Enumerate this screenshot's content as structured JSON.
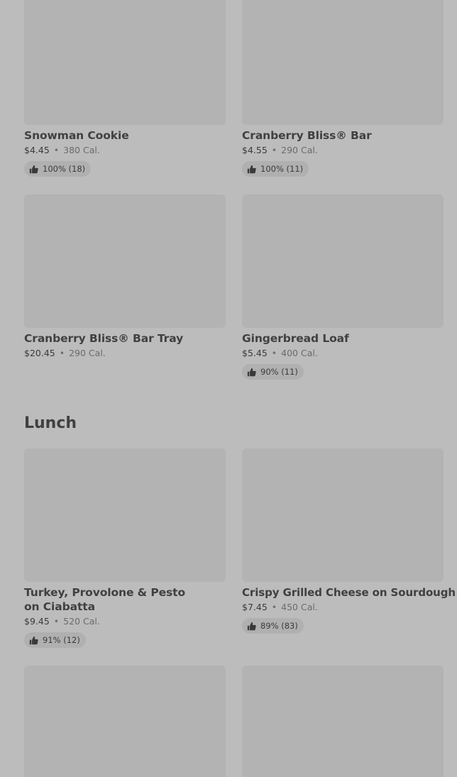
{
  "bakery": {
    "items": [
      {
        "name": "Snowman Cookie",
        "price": "$4.45",
        "sep": "•",
        "calories": "380 Cal.",
        "rating": "100% (18)"
      },
      {
        "name": "Cranberry Bliss® Bar",
        "price": "$4.55",
        "sep": "•",
        "calories": "290 Cal.",
        "rating": "100% (11)"
      },
      {
        "name": "Cranberry Bliss® Bar Tray",
        "price": "$20.45",
        "sep": "•",
        "calories": "290 Cal."
      },
      {
        "name": "Gingerbread Loaf",
        "price": "$5.45",
        "sep": "•",
        "calories": "400 Cal.",
        "rating": "90% (11)"
      }
    ]
  },
  "lunch": {
    "title": "Lunch",
    "items": [
      {
        "name": "Turkey, Provolone & Pesto on Ciabatta",
        "price": "$9.45",
        "sep": "•",
        "calories": "520 Cal.",
        "rating": "91% (12)"
      },
      {
        "name": "Crispy Grilled Cheese on Sourdough",
        "price": "$7.45",
        "sep": "•",
        "calories": "450 Cal.",
        "rating": "89% (83)"
      }
    ]
  },
  "icons": {
    "rating": "thumbs-up-icon"
  }
}
